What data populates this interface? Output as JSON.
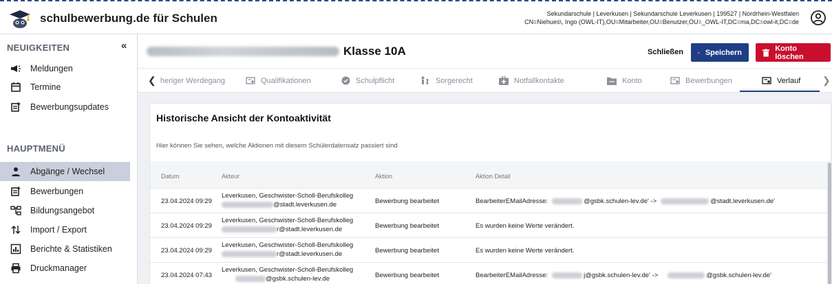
{
  "app": {
    "title": "schulbewerbung.de für Schulen",
    "user_line1": "Sekundarschule | Leverkusen | Sekundarschule Leverkusen | 199527 | Nordrhein-Westfalen",
    "user_line2": "CN=Niehues\\, Ingo (OWL-IT),OU=Mitarbeiter,OU=Benutzer,OU=_OWL-IT,DC=ma,DC=owl-it,DC=de"
  },
  "sidebar": {
    "news_title": "NEUIGKEITEN",
    "collapse_glyph": "«",
    "news_items": [
      {
        "label": "Meldungen",
        "icon": "megaphone-icon"
      },
      {
        "label": "Termine",
        "icon": "calendar-icon"
      },
      {
        "label": "Bewerbungsupdates",
        "icon": "document-plus-icon"
      }
    ],
    "main_title": "HAUPTMENÜ",
    "main_items": [
      {
        "label": "Abgänge / Wechsel",
        "icon": "person-icon",
        "active": true
      },
      {
        "label": "Bewerbungen",
        "icon": "document-plus-icon"
      },
      {
        "label": "Bildungsangebot",
        "icon": "sitemap-icon"
      },
      {
        "label": "Import / Export",
        "icon": "import-export-icon"
      },
      {
        "label": "Berichte & Statistiken",
        "icon": "chart-icon"
      },
      {
        "label": "Druckmanager",
        "icon": "printer-icon"
      }
    ]
  },
  "header": {
    "class_label": "Klasse 10A",
    "close_label": "Schließen",
    "save_label": "Speichern",
    "delete_label": "Konto löschen"
  },
  "tabs": [
    {
      "label": "heriger Werdegang",
      "icon": ""
    },
    {
      "label": "Qualifikationen",
      "icon": "certificate-icon"
    },
    {
      "label": "Schulpflicht",
      "icon": "badge-check-icon"
    },
    {
      "label": "Sorgerecht",
      "icon": "family-icon"
    },
    {
      "label": "Notfallkontakte",
      "icon": "first-aid-icon"
    },
    {
      "label": "Konto",
      "icon": "folder-icon"
    },
    {
      "label": "Bewerbungen",
      "icon": "certificate-icon"
    },
    {
      "label": "Verlauf",
      "icon": "certificate-icon",
      "active": true
    }
  ],
  "history": {
    "title": "Historische Ansicht der Kontoaktivität",
    "subtitle": "Hier können Sie sehen, welche Aktionen mit diesem Schülerdatensatz passiert sind",
    "columns": [
      "Datum",
      "Akteur",
      "Aktion",
      "Aktion Detail"
    ],
    "rows": [
      {
        "date": "23.04.2024 09:29",
        "actor1": "Leverkusen, Geschwister-Scholl-Berufskolleg",
        "actor2": "@stadt.leverkusen.de",
        "action": "Bewerbung bearbeitet",
        "detail_prefix": "BearbeiterEMailAdresse:",
        "detail_mid": "@gsbk.schulen-lev.de' ->",
        "detail_end": "@stadt.leverkusen.de'"
      },
      {
        "date": "23.04.2024 09:29",
        "actor1": "Leverkusen, Geschwister-Scholl-Berufskolleg",
        "actor2": "r@stadt.leverkusen.de",
        "action": "Bewerbung bearbeitet",
        "detail_prefix": "Es wurden keine Werte verändert.",
        "detail_mid": "",
        "detail_end": ""
      },
      {
        "date": "23.04.2024 09:29",
        "actor1": "Leverkusen, Geschwister-Scholl-Berufskolleg",
        "actor2": "r@stadt.leverkusen.de",
        "action": "Bewerbung bearbeitet",
        "detail_prefix": "Es wurden keine Werte verändert.",
        "detail_mid": "",
        "detail_end": ""
      },
      {
        "date": "23.04.2024 07:43",
        "actor1": "Leverkusen, Geschwister-Scholl-Berufskolleg",
        "actor2": "@gsbk.schulen-lev.de",
        "action": "Bewerbung bearbeitet",
        "detail_prefix": "BearbeiterEMailAdresse:",
        "detail_mid": "j@gsbk.schulen-lev.de' ->",
        "detail_end": "@gsbk.schulen-lev.de'"
      }
    ]
  },
  "colors": {
    "primary": "#1f3e85",
    "danger": "#c8102e",
    "active_nav": "#c9cfdd"
  }
}
